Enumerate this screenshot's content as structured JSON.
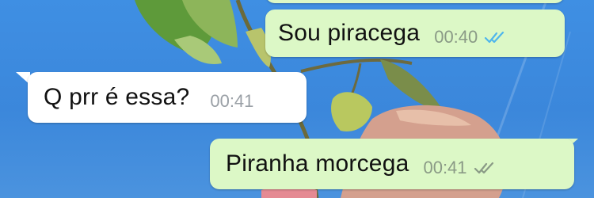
{
  "chat": {
    "messages": [
      {
        "direction": "outgoing",
        "text": "Sou piracega",
        "time": "00:40",
        "status": "read",
        "status_icon": "double-check-icon",
        "status_color": "#4fb6ec"
      },
      {
        "direction": "incoming",
        "text": "Q prr é essa?",
        "time": "00:41"
      },
      {
        "direction": "outgoing",
        "text": "Piranha morcega",
        "time": "00:41",
        "status": "delivered",
        "status_icon": "double-check-icon",
        "status_color": "#8a9a86"
      }
    ]
  },
  "colors": {
    "outgoing_bubble": "#dcf8c6",
    "incoming_bubble": "#ffffff",
    "wallpaper_sky": "#3f8fe3"
  }
}
